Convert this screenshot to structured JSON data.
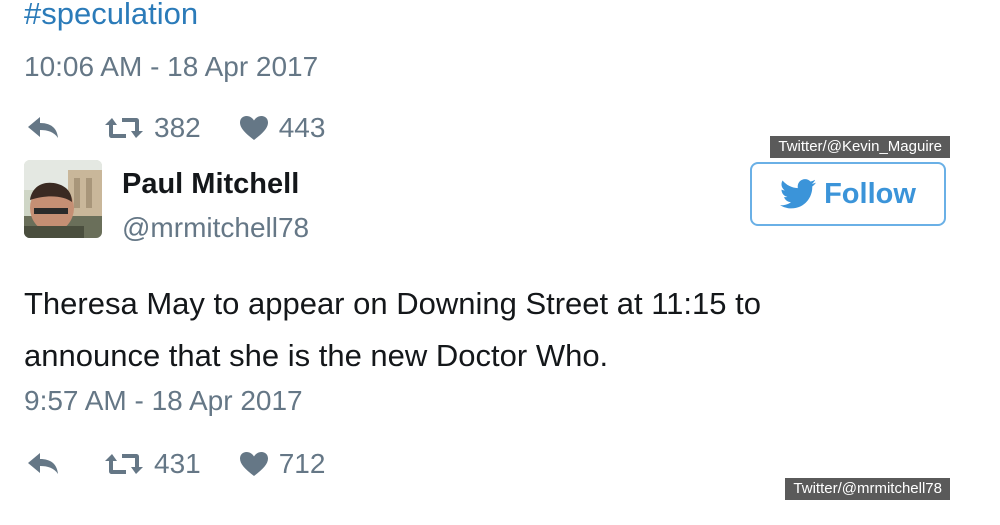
{
  "top_tweet": {
    "hashtag": "#speculation",
    "timestamp": "10:06 AM - 18 Apr 2017",
    "retweets": "382",
    "likes": "443",
    "credit": "Twitter/@Kevin_Maguire"
  },
  "main_tweet": {
    "author_name": "Paul Mitchell",
    "author_handle": "@mrmitchell78",
    "follow_label": "Follow",
    "text_line1": "Theresa May to appear on Downing Street at 11:15 to",
    "text_line2": "announce that she is the new Doctor Who.",
    "timestamp": "9:57 AM - 18 Apr 2017",
    "retweets": "431",
    "likes": "712",
    "credit": "Twitter/@mrmitchell78"
  },
  "icons": {
    "reply": "reply-icon",
    "retweet": "retweet-icon",
    "like": "heart-icon",
    "twitter": "twitter-bird-icon"
  },
  "colors": {
    "link": "#2b7bb9",
    "muted": "#657786",
    "follow_border": "#6ab0e6",
    "follow_text": "#3b94d9"
  }
}
